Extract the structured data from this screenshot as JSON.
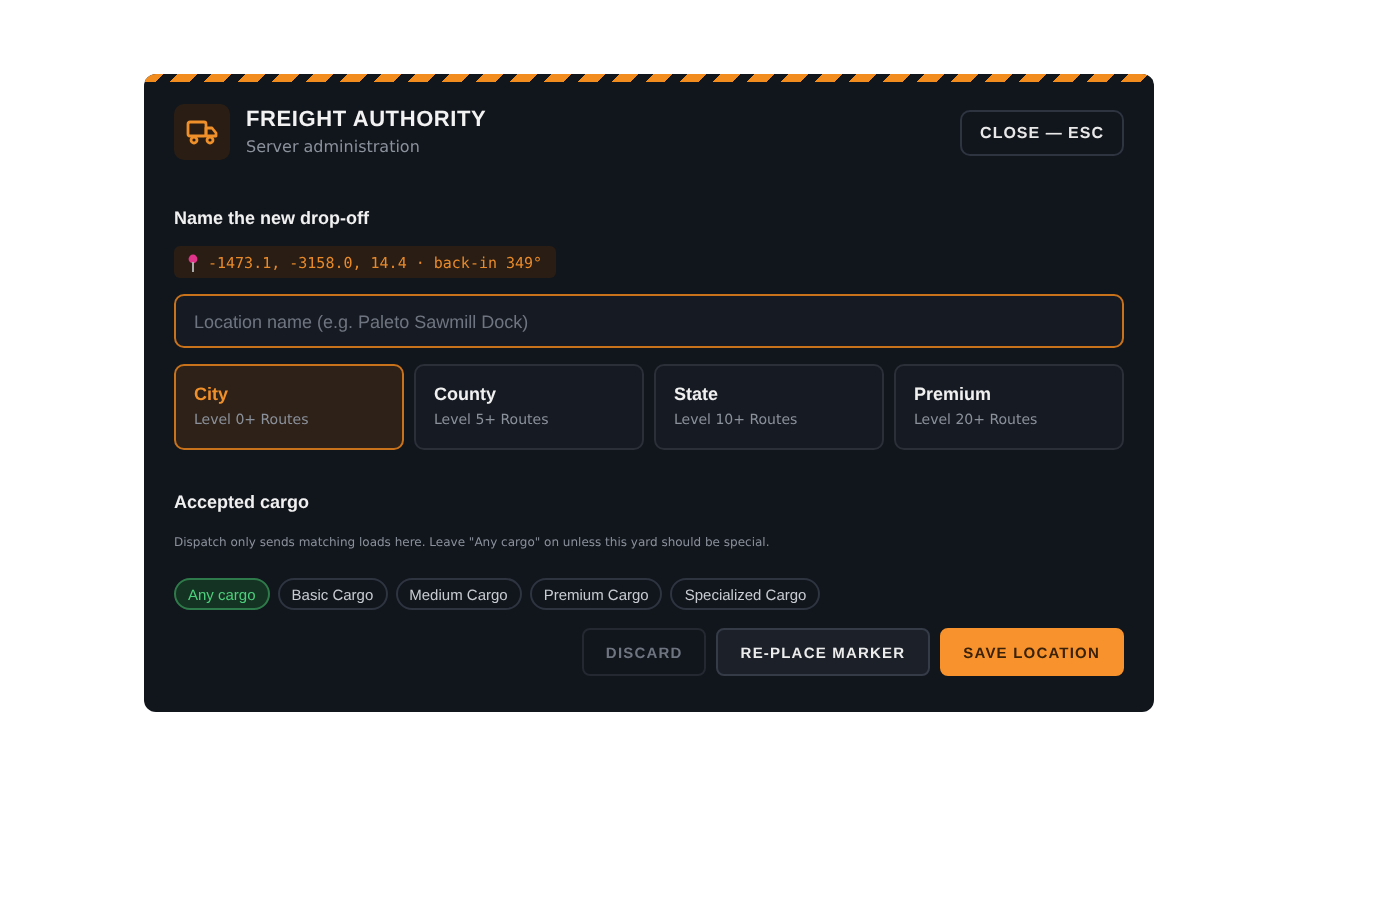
{
  "header": {
    "title": "FREIGHT AUTHORITY",
    "subtitle": "Server administration",
    "close_button": "CLOSE — ESC"
  },
  "name_section": {
    "heading": "Name the new drop-off",
    "coords": "-1473.1, -3158.0, 14.4 · back-in 349°",
    "placeholder": "Location name (e.g. Paleto Sawmill Dock)"
  },
  "tiers": [
    {
      "name": "City",
      "detail": "Level 0+ Routes",
      "selected": true
    },
    {
      "name": "County",
      "detail": "Level 5+ Routes",
      "selected": false
    },
    {
      "name": "State",
      "detail": "Level 10+ Routes",
      "selected": false
    },
    {
      "name": "Premium",
      "detail": "Level 20+ Routes",
      "selected": false
    }
  ],
  "cargo": {
    "heading": "Accepted cargo",
    "hint": "Dispatch only sends matching loads here. Leave \"Any cargo\" on unless this yard should be special.",
    "options": [
      {
        "label": "Any cargo",
        "selected": true
      },
      {
        "label": "Basic Cargo",
        "selected": false
      },
      {
        "label": "Medium Cargo",
        "selected": false
      },
      {
        "label": "Premium Cargo",
        "selected": false
      },
      {
        "label": "Specialized Cargo",
        "selected": false
      }
    ]
  },
  "buttons": [
    {
      "label": "DISCARD",
      "kind": "ghost"
    },
    {
      "label": "RE-PLACE MARKER",
      "kind": "secondary"
    },
    {
      "label": "SAVE LOCATION",
      "kind": "primary"
    }
  ]
}
